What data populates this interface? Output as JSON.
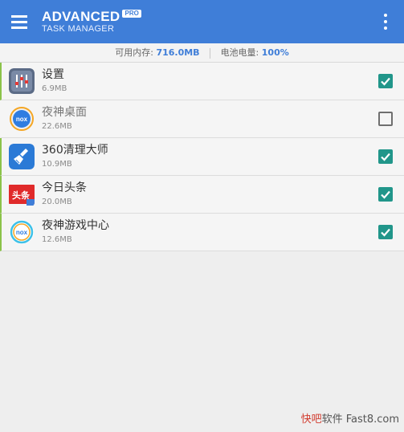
{
  "header": {
    "title": "ADVANCED",
    "badge": "PRO",
    "subtitle": "TASK MANAGER",
    "menu_icon": "hamburger-menu-icon",
    "overflow_icon": "more-vert-icon",
    "color": "#3f7ed8"
  },
  "status": {
    "memory_label": "可用内存:",
    "memory_value": "716.0MB",
    "battery_label": "电池电量:",
    "battery_value": "100%"
  },
  "apps": [
    {
      "name": "设置",
      "size": "6.9MB",
      "checked": true,
      "icon": "settings-sliders-icon"
    },
    {
      "name": "夜神桌面",
      "size": "22.6MB",
      "checked": false,
      "icon": "nox-launcher-icon"
    },
    {
      "name": "360清理大师",
      "size": "10.9MB",
      "checked": true,
      "icon": "broom-cleaner-icon"
    },
    {
      "name": "今日头条",
      "size": "20.0MB",
      "checked": true,
      "icon": "toutiao-icon"
    },
    {
      "name": "夜神游戏中心",
      "size": "12.6MB",
      "checked": true,
      "icon": "nox-game-center-icon"
    }
  ],
  "watermark": {
    "part1": "快吧",
    "part2": "软件 Fast8.com"
  },
  "colors": {
    "checkbox_on": "#21968a",
    "row_accent": "#8bc34a"
  }
}
